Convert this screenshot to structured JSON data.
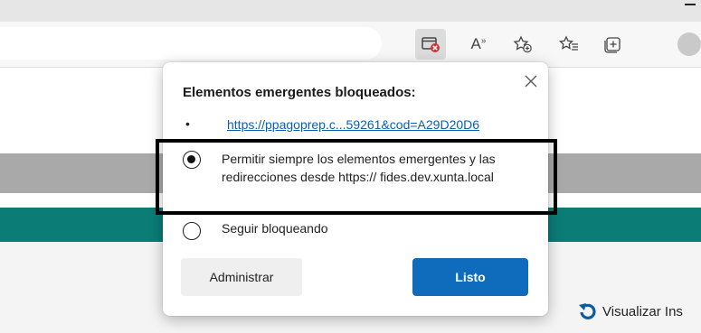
{
  "browser": {
    "toolbar_icons": [
      "popup-blocked-icon",
      "read-aloud-icon",
      "add-favorite-icon",
      "favorites-icon",
      "collections-icon",
      "profile-avatar"
    ],
    "read_aloud_glyph": "A",
    "read_aloud_superscript": "»"
  },
  "popup": {
    "title": "Elementos emergentes bloqueados:",
    "bullet": "•",
    "blocked_link": "https://ppagoprep.c...59261&cod=A29D20D6",
    "option_always_allow": "Permitir siempre los elementos emergentes y las redirecciones desde https:// fides.dev.xunta.local",
    "option_keep_blocking": "Seguir bloqueando",
    "selected_option": "always_allow",
    "manage_button": "Administrar",
    "done_button": "Listo"
  },
  "page": {
    "visualizar_label": "Visualizar Ins"
  },
  "colors": {
    "accent_blue": "#0f6cbd",
    "teal_band": "#0b7c76",
    "blocked_badge": "#d13438",
    "link": "#0a5fb5"
  }
}
